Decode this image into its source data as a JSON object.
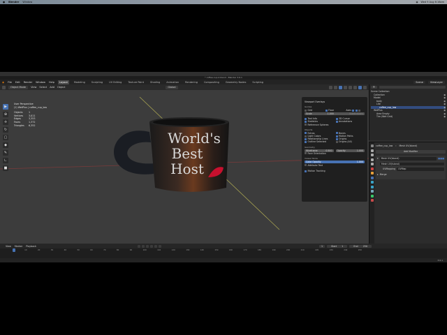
{
  "mac_menu": {
    "apple": "",
    "app": "Blender",
    "window": "Window",
    "clock": "Wed 9 Aug 6:16am"
  },
  "window_title": "* coffee-cup-2.blend - Blender 3.6.1",
  "topbar": {
    "menus": [
      "File",
      "Edit",
      "Render",
      "Window",
      "Help"
    ],
    "workspaces": [
      "Layout",
      "Modeling",
      "Sculpting",
      "UV Editing",
      "Texture Paint",
      "Shading",
      "Animation",
      "Rendering",
      "Compositing",
      "Geometry Nodes",
      "Scripting"
    ],
    "active_workspace": "Layout",
    "scene": "Scene",
    "view_layer": "ViewLayer"
  },
  "viewport_header": {
    "mode": "Object Mode",
    "menus": [
      "View",
      "Select",
      "Add",
      "Object"
    ],
    "transform": "Global"
  },
  "viewport_stats": {
    "view": "User Perspective",
    "object": "(1) WetPlus | coffee_cup_low",
    "rows": [
      {
        "label": "Objects",
        "value": "1"
      },
      {
        "label": "Vertices",
        "value": "3,011"
      },
      {
        "label": "Edges",
        "value": "3,353"
      },
      {
        "label": "Faces",
        "value": "1,372"
      },
      {
        "label": "Triangles",
        "value": "6,352"
      }
    ]
  },
  "mug": {
    "line1": "World's",
    "line2": "Best",
    "line3": "Host"
  },
  "overlays": {
    "title": "Viewport Overlays",
    "guides_label": "Guides",
    "guides": [
      [
        "Grid",
        "Floor",
        "Axes"
      ]
    ],
    "scale_label": "Scale",
    "scale_value": "1.000",
    "subdivisions": "Subdivisions",
    "options": [
      [
        "Text Info",
        "3D Cursor"
      ],
      [
        "Statistics",
        "Annotations"
      ],
      [
        "Reference Spheres",
        ""
      ]
    ],
    "objects_label": "Objects",
    "objects": [
      [
        "Extras",
        "Bones"
      ],
      [
        "Light Colors",
        "Motion Paths"
      ],
      [
        "Relationship Lines",
        "Origins"
      ],
      [
        "Outline Selected",
        "Origins (All)"
      ]
    ],
    "geometry_label": "Geometry",
    "wireframe": "Wireframe",
    "wireframe_value": "0.500",
    "opacity": "Opacity",
    "opacity_value": "1.000",
    "face_orientation": "Face Orientation",
    "viewer_node_label": "Viewer Node",
    "color_opacity": "Color Opacity",
    "color_opacity_value": "1.000",
    "attribute_text": "Attribute Text",
    "motion_tracking": "Motion Tracking"
  },
  "outliner": {
    "search": "",
    "rows": [
      {
        "name": "Scene Collection",
        "indent": 0
      },
      {
        "name": "Collection",
        "indent": 1
      },
      {
        "name": "Model",
        "indent": 1
      },
      {
        "name": "body",
        "indent": 2
      },
      {
        "name": "Lite",
        "indent": 2
      },
      {
        "name": "coffee_cup_low",
        "indent": 3
      },
      {
        "name": "WetPlus",
        "indent": 1
      },
      {
        "name": "Area Empty",
        "indent": 2
      },
      {
        "name": "Tim (Wet Grid)",
        "indent": 2
      }
    ]
  },
  "properties": {
    "breadcrumb_object": "coffee_cup_low",
    "breadcrumb_modifier": "Mesh UV(Island)",
    "add_modifier": "Add Modifier",
    "modifier_name": "Mesh UV(Island)",
    "sub_name": "Mesh UV(Island)",
    "uv_mapping_label": "UVMapping",
    "uv_mapping_value": "UVMap",
    "merge_label": "Merge"
  },
  "timeline": {
    "menus": [
      "View",
      "Marker",
      "Playback"
    ],
    "start_label": "Start",
    "start": "1",
    "end_label": "End",
    "end": "250",
    "current": "1",
    "frames": [
      "0",
      "10",
      "20",
      "30",
      "40",
      "50",
      "60",
      "70",
      "80",
      "90",
      "100",
      "110",
      "120",
      "130",
      "140",
      "150",
      "160",
      "170",
      "180",
      "190",
      "200",
      "210",
      "220",
      "230",
      "240",
      "250"
    ]
  },
  "statusbar": {
    "version": "3.6.1"
  },
  "colors": {
    "accent": "#4772b3",
    "lipstick": "#c8102e"
  }
}
